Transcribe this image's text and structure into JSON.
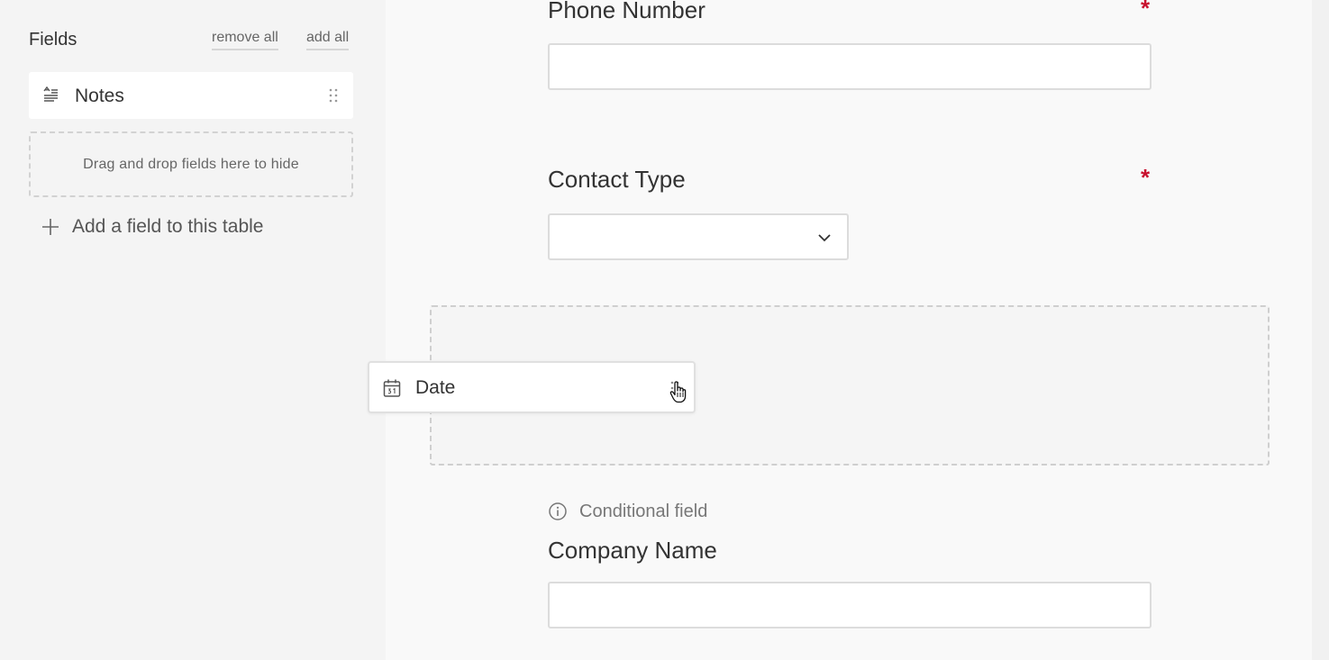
{
  "sidebar": {
    "title": "Fields",
    "remove_all": "remove all",
    "add_all": "add all",
    "fields": [
      {
        "label": "Notes",
        "icon": "long-text-icon"
      }
    ],
    "hide_zone_text": "Drag and drop fields here to hide",
    "add_field_label": "Add a field to this table"
  },
  "form": {
    "fields": [
      {
        "label": "Phone Number",
        "required_mark": "*",
        "type": "text",
        "value": ""
      },
      {
        "label": "Contact Type",
        "required_mark": "*",
        "type": "select",
        "value": ""
      },
      {
        "label": "Company Name",
        "type": "text",
        "value": "",
        "note": "Conditional field"
      }
    ]
  },
  "dragging_field": {
    "label": "Date",
    "icon": "calendar-icon"
  },
  "colors": {
    "required": "#c8102e",
    "sidebar_bg": "#f4f4f4",
    "main_bg": "#f9f9f9"
  }
}
